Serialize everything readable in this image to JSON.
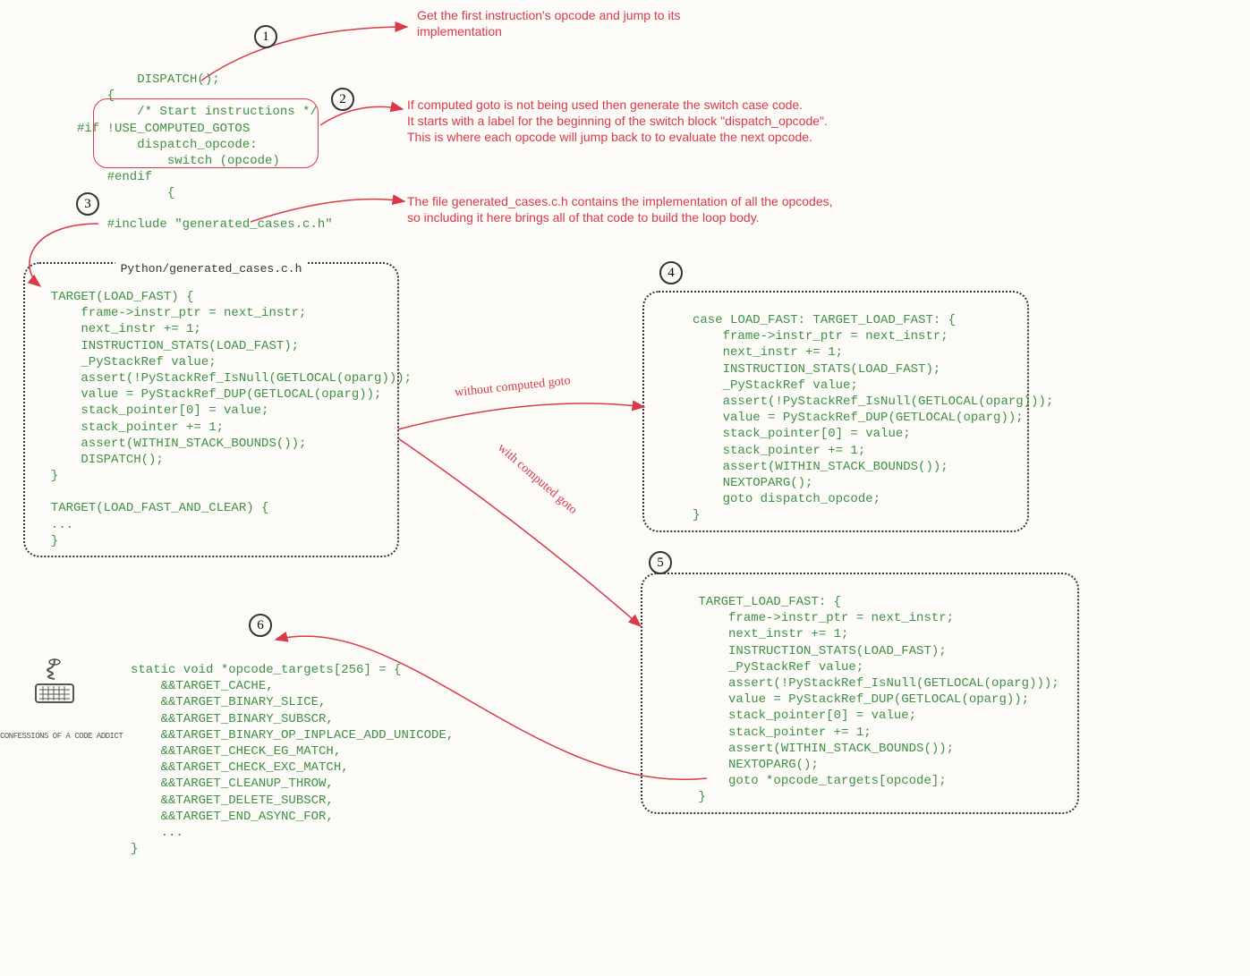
{
  "steps": {
    "s1": "1",
    "s2": "2",
    "s3": "3",
    "s4": "4",
    "s5": "5",
    "s6": "6"
  },
  "annotations": {
    "a1": "Get the first instruction's opcode and jump to its\nimplementation",
    "a2": "If computed goto is not being used then generate the switch case code.\nIt starts with a label for the beginning of the switch block \"dispatch_opcode\".\nThis is where each opcode will jump back to to evaluate the next opcode.",
    "a3": "The file generated_cases.c.h contains the implementation of all the opcodes,\nso including it here brings all of that code to build the loop body."
  },
  "code_main": {
    "dispatch": "        DISPATCH();",
    "open_brace": "    {",
    "comment_start": "        /* Start instructions */",
    "if_line": "#if !USE_COMPUTED_GOTOS",
    "label": "        dispatch_opcode:",
    "switch": "            switch (opcode)",
    "endif": "    #endif",
    "inner_brace": "            {",
    "include": "    #include \"generated_cases.c.h\""
  },
  "box_title": "Python/generated_cases.c.h",
  "box3_code": "  TARGET(LOAD_FAST) {\n      frame->instr_ptr = next_instr;\n      next_instr += 1;\n      INSTRUCTION_STATS(LOAD_FAST);\n      _PyStackRef value;\n      assert(!PyStackRef_IsNull(GETLOCAL(oparg)));\n      value = PyStackRef_DUP(GETLOCAL(oparg));\n      stack_pointer[0] = value;\n      stack_pointer += 1;\n      assert(WITHIN_STACK_BOUNDS());\n      DISPATCH();\n  }\n\n  TARGET(LOAD_FAST_AND_CLEAR) {\n  ...\n  }",
  "box4_code": "     case LOAD_FAST: TARGET_LOAD_FAST: {\n         frame->instr_ptr = next_instr;\n         next_instr += 1;\n         INSTRUCTION_STATS(LOAD_FAST);\n         _PyStackRef value;\n         assert(!PyStackRef_IsNull(GETLOCAL(oparg)));\n         value = PyStackRef_DUP(GETLOCAL(oparg));\n         stack_pointer[0] = value;\n         stack_pointer += 1;\n         assert(WITHIN_STACK_BOUNDS());\n         NEXTOPARG();\n         goto dispatch_opcode;\n     }",
  "box5_code": "      TARGET_LOAD_FAST: {\n          frame->instr_ptr = next_instr;\n          next_instr += 1;\n          INSTRUCTION_STATS(LOAD_FAST);\n          _PyStackRef value;\n          assert(!PyStackRef_IsNull(GETLOCAL(oparg)));\n          value = PyStackRef_DUP(GETLOCAL(oparg));\n          stack_pointer[0] = value;\n          stack_pointer += 1;\n          assert(WITHIN_STACK_BOUNDS());\n          NEXTOPARG();\n          goto *opcode_targets[opcode];\n      }",
  "box6_code": "static void *opcode_targets[256] = {\n    &&TARGET_CACHE,\n    &&TARGET_BINARY_SLICE,\n    &&TARGET_BINARY_SUBSCR,\n    &&TARGET_BINARY_OP_INPLACE_ADD_UNICODE,\n    &&TARGET_CHECK_EG_MATCH,\n    &&TARGET_CHECK_EXC_MATCH,\n    &&TARGET_CLEANUP_THROW,\n    &&TARGET_DELETE_SUBSCR,\n    &&TARGET_END_ASYNC_FOR,\n    ...\n}",
  "edge_labels": {
    "without": "without computed goto",
    "with": "with computed goto"
  },
  "watermark": "CONFESSIONS OF A CODE ADDICT"
}
